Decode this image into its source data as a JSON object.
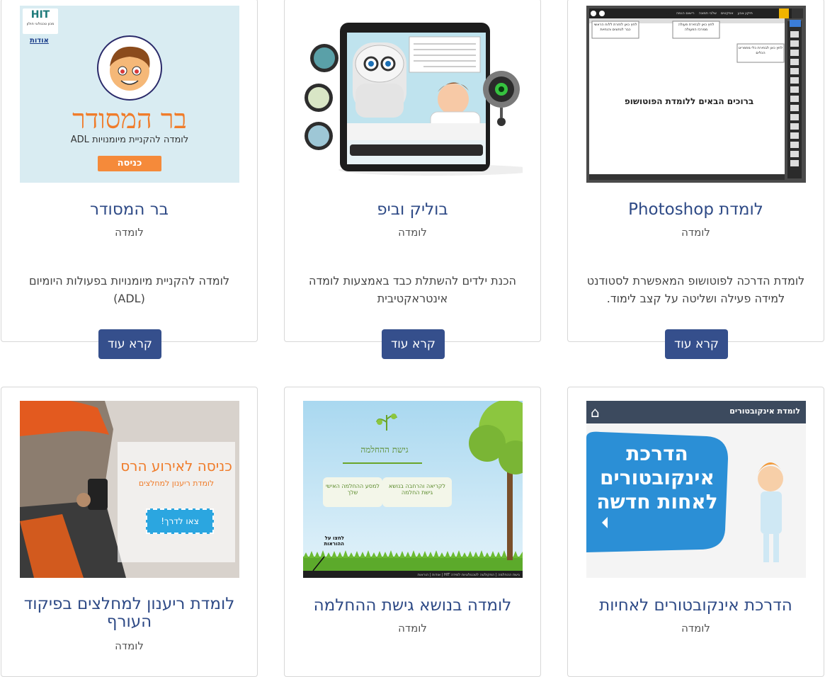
{
  "cards": [
    {
      "title": "לומדת Photoshop",
      "type": "לומדה",
      "description": "לומדת הדרכה לפוטושופ המאפשרת לסטודנט למידה פעילה ושליטה על קצב לימוד.",
      "button": "קרא עוד",
      "thumb": {
        "heading": "ברוכים הבאים ללומדת הפוטושופ",
        "tabs": [
          "ראשי",
          "רישום הגמה",
          "שלבי תמונה",
          "אפקטים",
          "תיקון צבע"
        ],
        "callouts": [
          "לחץ כאן לחזרת ללוח הראשי כבר לנתונים והנחיות",
          "לחץ כאן לבחירת פעולה ממרכז הפעולה",
          "לחץ כאן לבחירת כלי מתפריט הכלים"
        ]
      }
    },
    {
      "title": "בוליק וביפ",
      "type": "לומדה",
      "description": "הכנת ילדים להשתלת כבד באמצעות לומדה אינטראקטיבית",
      "button": "קרא עוד"
    },
    {
      "title": "בר המסודר",
      "type": "לומדה",
      "description": "לומדה להקניית מיומנויות בפעולות היומיום (ADL)",
      "button": "קרא עוד",
      "thumb": {
        "logo": "HIT",
        "logo_sub": "מכון טכנולוגי חולון",
        "about": "אודות",
        "heading": "בר המסודר",
        "subheading": "לומדה להקניית מיומנויות ADL",
        "enter": "כניסה"
      }
    },
    {
      "title": "הדרכת אינקובטורים לאחיות",
      "type": "לומדה",
      "thumb": {
        "bar": "לומדת אינקובטורים",
        "heading_lines": [
          "הדרכת",
          "אינקובטורים",
          "לאחות חדשה"
        ]
      }
    },
    {
      "title": "לומדה בנושא גישת ההחלמה",
      "type": "לומדה",
      "thumb": {
        "logo_text": "גישת ההחלמה",
        "box1": "לקריאה והרחבה בנושא גישת החלמה",
        "box2": "למסע ההחלמה האישי שלך",
        "hint": "לחצו על ההוראות",
        "footer": "גישת ההחלמה | הפקולטה לטכנולוגיות למידה HIT | אודות | הוראות"
      }
    },
    {
      "title": "לומדת ריענון למחלצים בפיקוד העורף",
      "type": "לומדה",
      "thumb": {
        "heading": "כניסה לאירוע הרס",
        "subheading": "לומדת ריענון למחלצים",
        "cta": "צאו לדרך!"
      }
    }
  ],
  "colors": {
    "title": "#2e4a86",
    "button": "#354f8c",
    "orange": "#f07c2a",
    "blue": "#2b8fd6"
  }
}
